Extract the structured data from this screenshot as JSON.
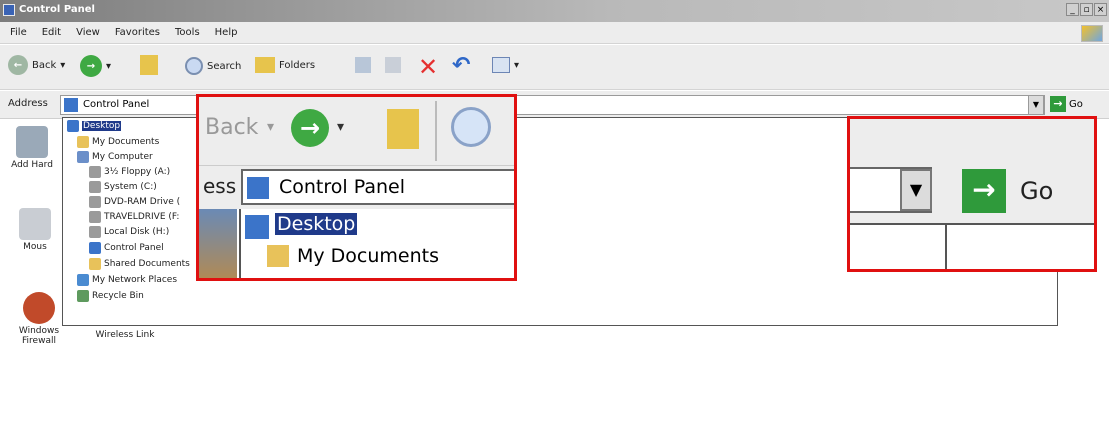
{
  "window": {
    "title": "Control Panel"
  },
  "menu": [
    "File",
    "Edit",
    "View",
    "Favorites",
    "Tools",
    "Help"
  ],
  "toolbar": {
    "back": "Back",
    "search": "Search",
    "folders": "Folders"
  },
  "address": {
    "label": "Address",
    "value": "Control Panel",
    "go": "Go"
  },
  "content_icons": [
    {
      "label": "Add Hard"
    },
    {
      "label": "Mous"
    },
    {
      "label": "Windows Firewall"
    },
    {
      "label": "Wireless Link"
    }
  ],
  "tree": [
    {
      "label": "Desktop",
      "selected": true,
      "color": "#3b74c9"
    },
    {
      "label": "My Documents",
      "color": "#e8c25a"
    },
    {
      "label": "My Computer",
      "color": "#6b8fc9"
    },
    {
      "label": "3½ Floppy (A:)",
      "color": "#9a9a9a"
    },
    {
      "label": "System (C:)",
      "color": "#9a9a9a"
    },
    {
      "label": "DVD-RAM Drive (",
      "color": "#9a9a9a"
    },
    {
      "label": "TRAVELDRIVE (F:",
      "color": "#9a9a9a"
    },
    {
      "label": "Local Disk (H:)",
      "color": "#9a9a9a"
    },
    {
      "label": "Control Panel",
      "color": "#3b74c9"
    },
    {
      "label": "Shared Documents",
      "color": "#e8c25a"
    },
    {
      "label": "My Network Places",
      "color": "#4a8bd1"
    },
    {
      "label": "Recycle Bin",
      "color": "#5e9a5e"
    }
  ],
  "zoom1": {
    "back": "Back",
    "address_partial": "ess",
    "address_value": "Control Panel",
    "item_selected": "Desktop",
    "item_next": "My Documents"
  },
  "zoom2": {
    "go": "Go"
  },
  "colors": {
    "highlight": "#e01010",
    "selection": "#1f3a8a",
    "go_green": "#2f9a3b"
  }
}
